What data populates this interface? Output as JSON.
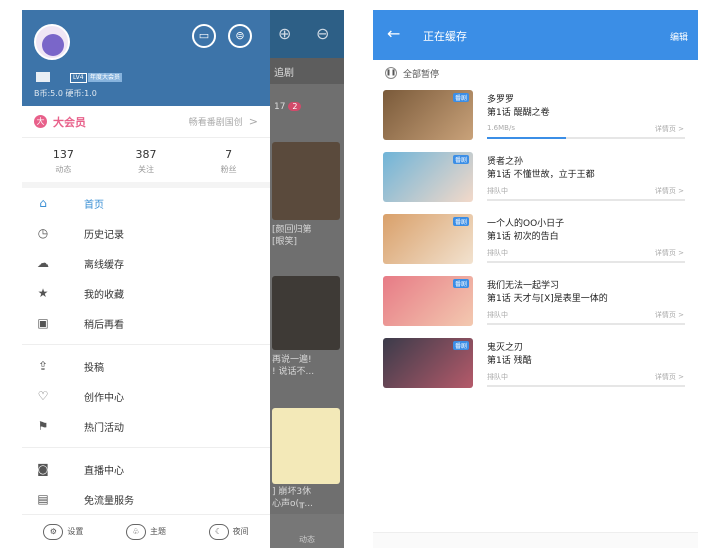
{
  "left": {
    "bg_app": {
      "tab_label": "追剧",
      "badge": "2",
      "card_text_1": "[颜回归第\n[眼笑]",
      "card_text_2": "再说一遍!\n! 说话不...",
      "card_text_3": "] 崩坏3休\n心声o(╥..."
    },
    "drawer": {
      "level_badge": "LV4",
      "vip_badge": "年度大会员",
      "coins": "B币:5.0  硬币:1.0",
      "vip_label": "大会员",
      "vip_promo": "畅看番剧国创",
      "stats": [
        {
          "num": "137",
          "label": "动态"
        },
        {
          "num": "387",
          "label": "关注"
        },
        {
          "num": "7",
          "label": "粉丝"
        }
      ],
      "menu_group1": [
        {
          "label": "首页",
          "icon": "home-icon",
          "glyph": "⌂"
        },
        {
          "label": "历史记录",
          "icon": "history-icon",
          "glyph": "◷"
        },
        {
          "label": "离线缓存",
          "icon": "cloud-download-icon",
          "glyph": "☁"
        },
        {
          "label": "我的收藏",
          "icon": "star-icon",
          "glyph": "★"
        },
        {
          "label": "稍后再看",
          "icon": "watch-later-icon",
          "glyph": "▣"
        }
      ],
      "menu_group2": [
        {
          "label": "投稿",
          "icon": "upload-icon",
          "glyph": "⇪"
        },
        {
          "label": "创作中心",
          "icon": "creator-icon",
          "glyph": "♡"
        },
        {
          "label": "热门活动",
          "icon": "flag-icon",
          "glyph": "⚑"
        }
      ],
      "menu_group3": [
        {
          "label": "直播中心",
          "icon": "live-icon",
          "glyph": "◙"
        },
        {
          "label": "免流量服务",
          "icon": "sim-icon",
          "glyph": "▤"
        }
      ],
      "footer": [
        {
          "label": "设置",
          "icon": "settings-icon",
          "glyph": "⚙"
        },
        {
          "label": "主题",
          "icon": "theme-icon",
          "glyph": "♧"
        },
        {
          "label": "夜间",
          "icon": "night-mode-icon",
          "glyph": "☾"
        }
      ],
      "bottom_tab": "动态"
    }
  },
  "right": {
    "title": "正在缓存",
    "edit": "编辑",
    "pause_all": "全部暂停",
    "items": [
      {
        "title": "多罗罗",
        "episode": "第1话 醍醐之卷",
        "status": "1.6MB/s",
        "detail": "详情页 >",
        "tag": "番剧",
        "progress": 0.4,
        "colors": [
          "#7a5a3a",
          "#c9a27a"
        ]
      },
      {
        "title": "贤者之孙",
        "episode": "第1话 不懂世故，立于王都",
        "status": "排队中",
        "detail": "详情页 >",
        "tag": "番剧",
        "progress": 0,
        "colors": [
          "#6fb4d8",
          "#f3d9c9"
        ]
      },
      {
        "title": "一个人的OO小日子",
        "episode": "第1话 初次的告白",
        "status": "排队中",
        "detail": "详情页 >",
        "tag": "番剧",
        "progress": 0,
        "colors": [
          "#d9a06a",
          "#f2e2cf"
        ]
      },
      {
        "title": "我们无法一起学习",
        "episode": "第1话 天才与[X]是表里一体的",
        "status": "排队中",
        "detail": "详情页 >",
        "tag": "番剧",
        "progress": 0,
        "colors": [
          "#e77b86",
          "#f3c9b0"
        ]
      },
      {
        "title": "鬼灭之刃",
        "episode": "第1话 残酷",
        "status": "排队中",
        "detail": "详情页 >",
        "tag": "番剧",
        "progress": 0,
        "colors": [
          "#3b3b4a",
          "#b55a6a"
        ]
      }
    ]
  }
}
